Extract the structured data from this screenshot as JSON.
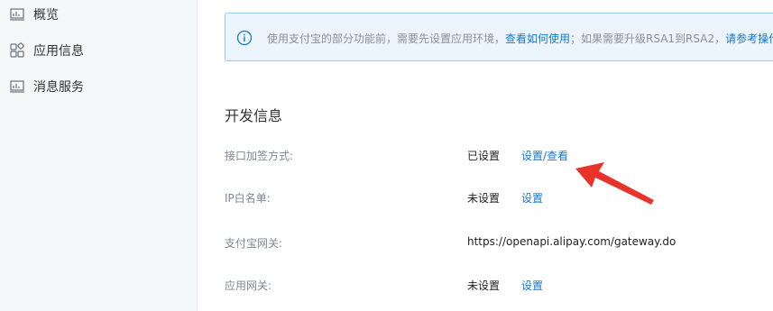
{
  "sidebar": {
    "items": [
      {
        "label": "概览",
        "icon": "overview-icon"
      },
      {
        "label": "应用信息",
        "icon": "app-info-icon"
      },
      {
        "label": "消息服务",
        "icon": "message-service-icon"
      }
    ]
  },
  "notice": {
    "text_before": "使用支付宝的部分功能前，需要先设置应用环境，",
    "link1": "查看如何使用",
    "text_middle": "；如果需要升级RSA1到RSA2，",
    "link2": "请参考操作",
    "icon": "info-icon",
    "accent_color": "#1677c8"
  },
  "section": {
    "title": "开发信息"
  },
  "rows": [
    {
      "label": "接口加签方式:",
      "value": "已设置",
      "link": "设置/查看"
    },
    {
      "label": "IP白名单:",
      "value": "未设置",
      "link": "设置"
    },
    {
      "label": "支付宝网关:",
      "value": "https://openapi.alipay.com/gateway.do",
      "link": ""
    },
    {
      "label": "应用网关:",
      "value": "未设置",
      "link": "设置"
    }
  ],
  "annotation": {
    "type": "red-arrow",
    "color": "#e8332a"
  }
}
